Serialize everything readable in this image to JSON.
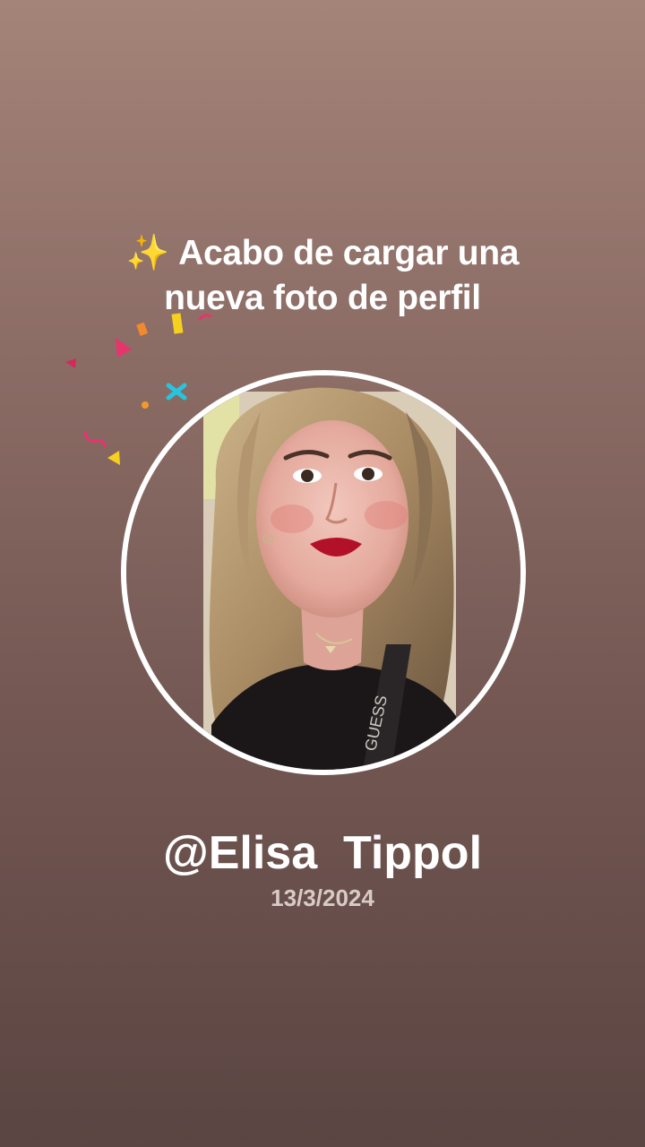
{
  "headline": {
    "icon": "sparkles-icon",
    "line1": "Acabo de cargar una",
    "line2": "nueva foto de perfil"
  },
  "profile": {
    "username": "@Elisa  Tippol",
    "date": "13/3/2024"
  },
  "colors": {
    "background_top": "#a48478",
    "background_bottom": "#5a4542",
    "ring": "#ffffff",
    "text": "#ffffff",
    "date_text": "#d8cbc7"
  }
}
